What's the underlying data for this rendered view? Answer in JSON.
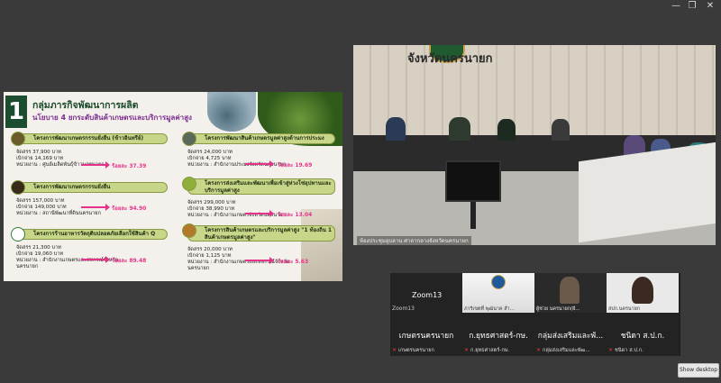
{
  "window": {
    "minimize_glyph": "—",
    "maximize_glyph": "❐",
    "close_glyph": "✕"
  },
  "slide": {
    "number": "1",
    "title": "กลุ่มภารกิจพัฒนาการผลิต",
    "subtitle": "นโยบาย 4 ยกระดับสินค้าเกษตรและบริการมูลค่าสูง",
    "projects": [
      {
        "name": "โครงการพัฒนาเกษตรกรรมยั่งยืน (ข้าวอินทรีย์)",
        "lines": [
          "จัดสรร 37,900 บาท",
          "เบิกจ่าย 14,169 บาท",
          "หน่วยงาน : ศูนย์เมล็ดพันธุ์ข้าวนครนายก"
        ],
        "percent": "ร้อยละ 37.39"
      },
      {
        "name": "โครงการพัฒนาเกษตรกรรมยั่งยืน",
        "lines": [
          "จัดสรร 157,000 บาท",
          "เบิกจ่าย 149,000 บาท",
          "หน่วยงาน : สถานีพัฒนาที่ดินนครนายก"
        ],
        "percent": "ร้อยละ 94.90"
      },
      {
        "name": "โครงการร้านอาหารวัตถุดิบปลอดภัยเลือกใช้สินค้า Q",
        "lines": [
          "จัดสรร 21,300 บาท",
          "เบิกจ่าย 19,060 บาท",
          "หน่วยงาน : สำนักงานเกษตรและสหกรณ์จังหวัด",
          "นครนายก"
        ],
        "percent": "ร้อยละ 89.48"
      },
      {
        "name": "โครงการพัฒนาสินค้าเกษตรมูลค่าสูงด้านการประมง",
        "lines": [
          "จัดสรร 24,000 บาท",
          "เบิกจ่าย 4,725 บาท",
          "หน่วยงาน : สำนักงานประมงจังหวัดนครนายก"
        ],
        "percent": "ร้อยละ 19.69"
      },
      {
        "name": "โครงการส่งเสริมและพัฒนาเพื่อเข้าสู่ห่วงโซ่อุปทานและบริการมูลค่าสูง",
        "lines": [
          "จัดสรร 299,000 บาท",
          "เบิกจ่าย 38,990 บาท",
          "หน่วยงาน : สำนักงานเกษตรจังหวัดนครนายก"
        ],
        "percent": "ร้อยละ 13.04"
      },
      {
        "name": "โครงการสินค้าเกษตรและบริการมูลค่าสูง \"1 ท้องถิ่น 1 สินค้าเกษตรมูลค่าสูง\"",
        "lines": [
          "จัดสรร 20,000 บาท",
          "เบิกจ่าย 1,125 บาท",
          "หน่วยงาน : สำนักงานเกษตรและสหกรณ์จังหวัด",
          "นครนายก"
        ],
        "percent": "ร้อยละ 5.63"
      }
    ]
  },
  "room": {
    "banner": "จังหวัดนครนายก",
    "caption": "ห้องประชุมอุบลาน ศาลากลางจังหวัดนครนายก"
  },
  "gallery": {
    "zoom_title": "Zoom13",
    "tiles": [
      {
        "big": "เกษตรนครนายก",
        "name": "เกษตรนครนายก",
        "video_label": "Zoom13"
      },
      {
        "big": "ก.ยุทธศาสตร์-กษ.",
        "name": "ก.ยุทธศาสตร์-กษ.",
        "video_label": "ภาริเขตที่ พุฒินาค สำ..."
      },
      {
        "big": "กลุ่มส่งเสริมและพั...",
        "name": "กลุ่มส่งเสริมและพัฒ...",
        "video_label": "ผู้ช่วย นครนายก(ฝั..."
      },
      {
        "big": "ชนิดา ส.ป.ก.",
        "name": "ชนิดา ส.ป.ก.",
        "video_label": "สปก.นครนายก"
      }
    ]
  },
  "show_desktop": "Show desktop"
}
